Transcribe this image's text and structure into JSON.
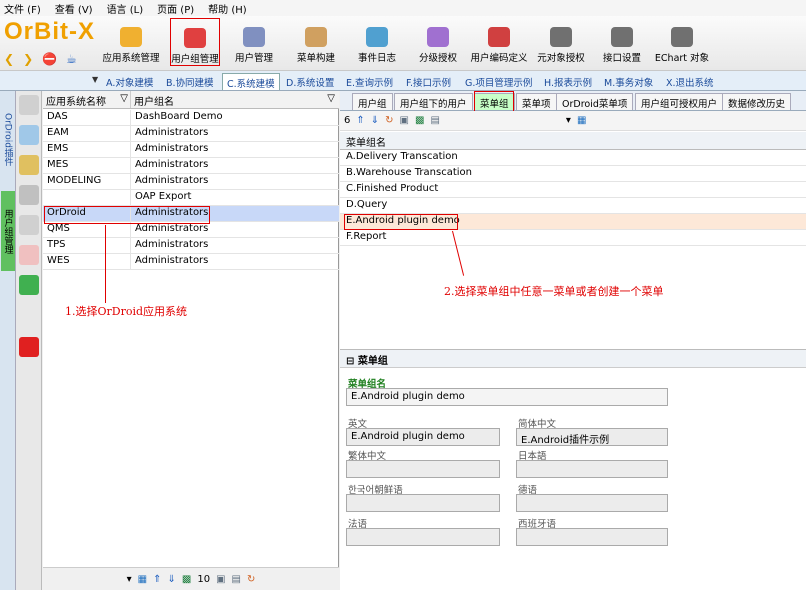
{
  "menu": [
    "文件 (F)",
    "查看 (V)",
    "语言 (L)",
    "页面 (P)",
    "帮助 (H)"
  ],
  "logo": "OrBit-X",
  "toolbar": [
    "应用系统管理",
    "用户组管理",
    "用户管理",
    "菜单构建",
    "事件日志",
    "分级授权",
    "用户编码定义",
    "元对象授权",
    "接口设置",
    "EChart 对象"
  ],
  "main_tabs": [
    "A.对象建模",
    "B.协同建模",
    "C.系统建模",
    "D.系统设置",
    "E.查询示例",
    "F.接口示例",
    "G.项目管理示例",
    "H.报表示例",
    "M.事务对象",
    "X.退出系统"
  ],
  "side_tabs": [
    "OrDroid插件",
    "用户组管理"
  ],
  "left_table": {
    "headers": [
      "应用系统名称",
      "用户组名"
    ],
    "rows": [
      [
        "DAS",
        "DashBoard Demo"
      ],
      [
        "EAM",
        "Administrators"
      ],
      [
        "EMS",
        "Administrators"
      ],
      [
        "MES",
        "Administrators"
      ],
      [
        "MODELING",
        "Administrators"
      ],
      [
        "",
        "OAP Export"
      ],
      [
        "OrDroid",
        "Administrators"
      ],
      [
        "QMS",
        "Administrators"
      ],
      [
        "TPS",
        "Administrators"
      ],
      [
        "WES",
        "Administrators"
      ]
    ],
    "footer_count": "10"
  },
  "right_tabs": [
    "用户组",
    "用户组下的用户",
    "菜单组",
    "菜单项",
    "OrDroid菜单项",
    "用户组可授权用户",
    "数据修改历史"
  ],
  "right_table": {
    "toolbar_count": "6",
    "header": "菜单组名",
    "rows": [
      "A.Delivery Transcation",
      "B.Warehouse Transcation",
      "C.Finished Product",
      "D.Query",
      "E.Android plugin demo",
      "F.Report"
    ]
  },
  "detail": {
    "title": "菜单组",
    "name_label": "菜单组名",
    "name_value": "E.Android plugin demo",
    "fields": [
      {
        "label": "英文",
        "value": "E.Android plugin demo"
      },
      {
        "label": "简体中文",
        "value": "E.Android插件示例"
      },
      {
        "label": "繁体中文",
        "value": ""
      },
      {
        "label": "日本語",
        "value": ""
      },
      {
        "label": "한국어朝鲜语",
        "value": ""
      },
      {
        "label": "德语",
        "value": ""
      },
      {
        "label": "法语",
        "value": ""
      },
      {
        "label": "西班牙语",
        "value": ""
      }
    ]
  },
  "annotations": {
    "a1": "1.选择OrDroid应用系统",
    "a2": "2.选择菜单组中任意一菜单或者创建一个菜单"
  }
}
